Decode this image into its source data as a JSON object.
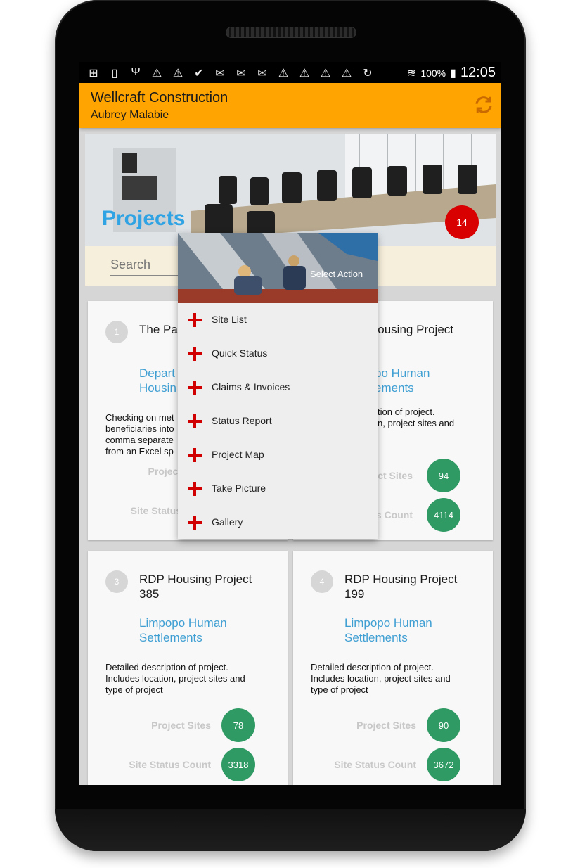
{
  "statusbar": {
    "battery": "100%",
    "time": "12:05",
    "icons": [
      "add-icon",
      "sim-1-icon",
      "usb-icon",
      "warning-icon",
      "warning-icon",
      "check-icon",
      "mail-icon",
      "mail-icon",
      "mail-icon",
      "warning-icon",
      "warning-icon",
      "warning-icon",
      "warning-icon",
      "sync-icon",
      "wifi-icon",
      "battery-icon"
    ]
  },
  "app": {
    "title": "Wellcraft Construction",
    "subtitle": "Aubrey Malabie",
    "accent": "#FFA400"
  },
  "hero": {
    "title": "Projects",
    "count": "14"
  },
  "search": {
    "placeholder": "Search"
  },
  "cards": [
    {
      "number": "1",
      "title": "The Pa",
      "org": "Depart\nHousin",
      "description": "Checking on met\nbeneficiaries into\ncomma separate\nfrom an Excel sp",
      "sites_label": "Project",
      "status_label": "Site Status",
      "sites": "",
      "status": ""
    },
    {
      "number": "",
      "title": "Housing Project",
      "org": "po Human\nements",
      "description": "tion of project.\nn, project sites and",
      "sites_label": "ct Sites",
      "status_label": "s Count",
      "sites": "94",
      "status": "4114"
    },
    {
      "number": "3",
      "title": "RDP Housing Project\n385",
      "org": "Limpopo Human\nSettlements",
      "description": "Detailed description of project.\nIncludes location, project sites and\ntype of project",
      "sites_label": "Project Sites",
      "status_label": "Site Status Count",
      "sites": "78",
      "status": "3318"
    },
    {
      "number": "4",
      "title": "RDP Housing Project\n199",
      "org": "Limpopo Human\nSettlements",
      "description": "Detailed description of project.\nIncludes location, project sites and\ntype of project",
      "sites_label": "Project Sites",
      "status_label": "Site Status Count",
      "sites": "90",
      "status": "3672"
    }
  ],
  "popup": {
    "title": "Select Action",
    "items": [
      "Site List",
      "Quick Status",
      "Claims & Invoices",
      "Status Report",
      "Project Map",
      "Take Picture",
      "Gallery"
    ]
  }
}
